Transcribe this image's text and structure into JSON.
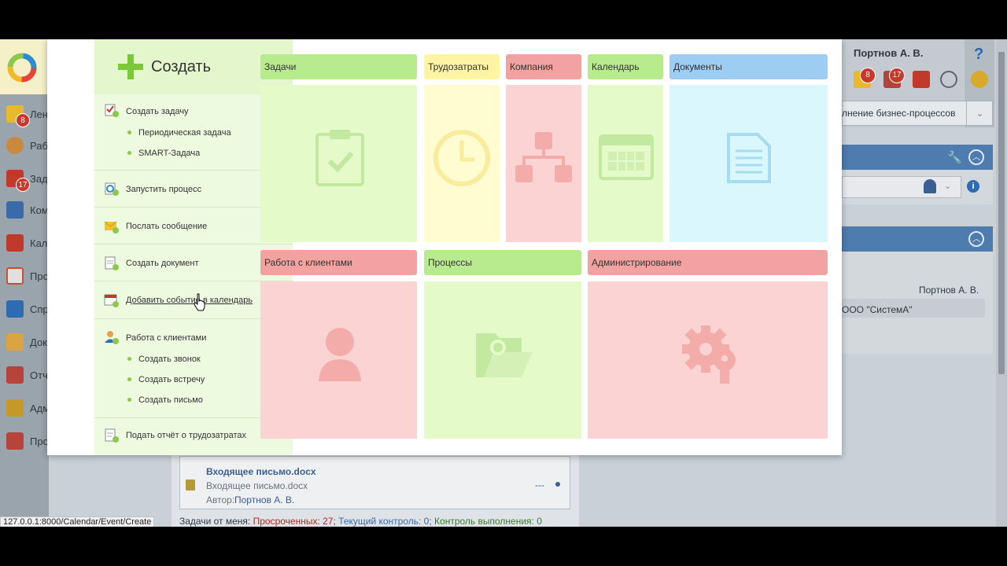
{
  "background": {
    "sidebar": {
      "items": [
        {
          "label": "Лен",
          "badge": "8"
        },
        {
          "label": "Раб",
          "badge": ""
        },
        {
          "label": "Зад",
          "badge": "17"
        },
        {
          "label": "Ком",
          "badge": ""
        },
        {
          "label": "Кал",
          "badge": ""
        },
        {
          "label": "Про",
          "badge": ""
        },
        {
          "label": "Спр",
          "badge": ""
        },
        {
          "label": "Док",
          "badge": ""
        },
        {
          "label": "Отч",
          "badge": ""
        },
        {
          "label": "Адм",
          "badge": ""
        },
        {
          "label": "Про",
          "badge": ""
        }
      ]
    },
    "header": {
      "user_name": "Портнов А. В.",
      "help": "?",
      "mail_badge": "8",
      "tasks_badge": "17",
      "bp_dropdown": "лнение бизнес-процессов"
    },
    "panel": {
      "author": "Портнов А. В.",
      "org": "ООО \"СистемА\""
    },
    "card": {
      "title": "Входящее письмо.docx",
      "subtitle": "Входящее письмо.docx",
      "author_label": "Автор:",
      "author": "Портнов А. В.",
      "dots": "---"
    },
    "tasks_line": {
      "prefix": "Задачи от меня:",
      "overdue": "Просроченных: 27;",
      "current": "Текущий контроль: 0;",
      "done": "Контроль выполнения: 0"
    },
    "status_url": "127.0.0.1:8000/Calendar/Event/Create"
  },
  "create_menu": {
    "title": "Создать",
    "items": {
      "create_task": "Создать задачу",
      "periodic_task": "Периодическая задача",
      "smart_task": "SMART-Задача",
      "start_process": "Запустить процесс",
      "send_message": "Послать сообщение",
      "create_document": "Создать документ",
      "add_event": "Добавить событие в календарь",
      "clients": "Работа с клиентами",
      "create_call": "Создать звонок",
      "create_meeting": "Создать встречу",
      "create_letter": "Создать письмо",
      "submit_report": "Подать отчёт о трудозатратах"
    }
  },
  "tiles": {
    "tasks": "Задачи",
    "labor": "Трудозатраты",
    "company": "Компания",
    "calendar": "Календарь",
    "documents": "Документы",
    "clients": "Работа с клиентами",
    "processes": "Процессы",
    "admin": "Администрирование"
  },
  "colors": {
    "green_head": "#b8ea8e",
    "green_body": "#e4fac8",
    "yellow_head": "#fdf4a4",
    "red_head": "#f2a2a0",
    "blue_head": "#9dcdf2"
  }
}
